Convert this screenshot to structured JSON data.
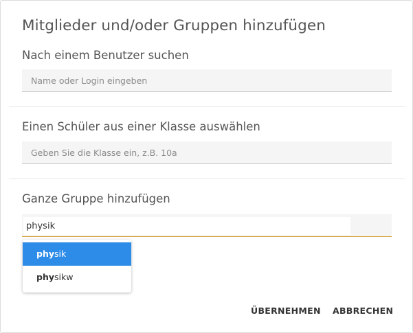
{
  "dialog": {
    "title": "Mitglieder und/oder Gruppen hinzufügen"
  },
  "user_search": {
    "label": "Nach einem Benutzer suchen",
    "placeholder": "Name oder Login eingeben",
    "value": ""
  },
  "class_select": {
    "label": "Einen Schüler aus einer Klasse auswählen",
    "placeholder": "Geben Sie die Klasse ein, z.B. 10a",
    "value": ""
  },
  "group_add": {
    "label": "Ganze Gruppe hinzufügen",
    "value": "physik",
    "accent_color": "#d8a84a"
  },
  "suggestions": [
    {
      "match": "phy",
      "rest": "sik",
      "selected": true
    },
    {
      "match": "phy",
      "rest": "sikw",
      "selected": false
    }
  ],
  "actions": {
    "apply_label": "ÜBERNEHMEN",
    "cancel_label": "ABBRECHEN"
  },
  "colors": {
    "selection": "#2d8ce8",
    "field_background": "#f5f5f5"
  }
}
